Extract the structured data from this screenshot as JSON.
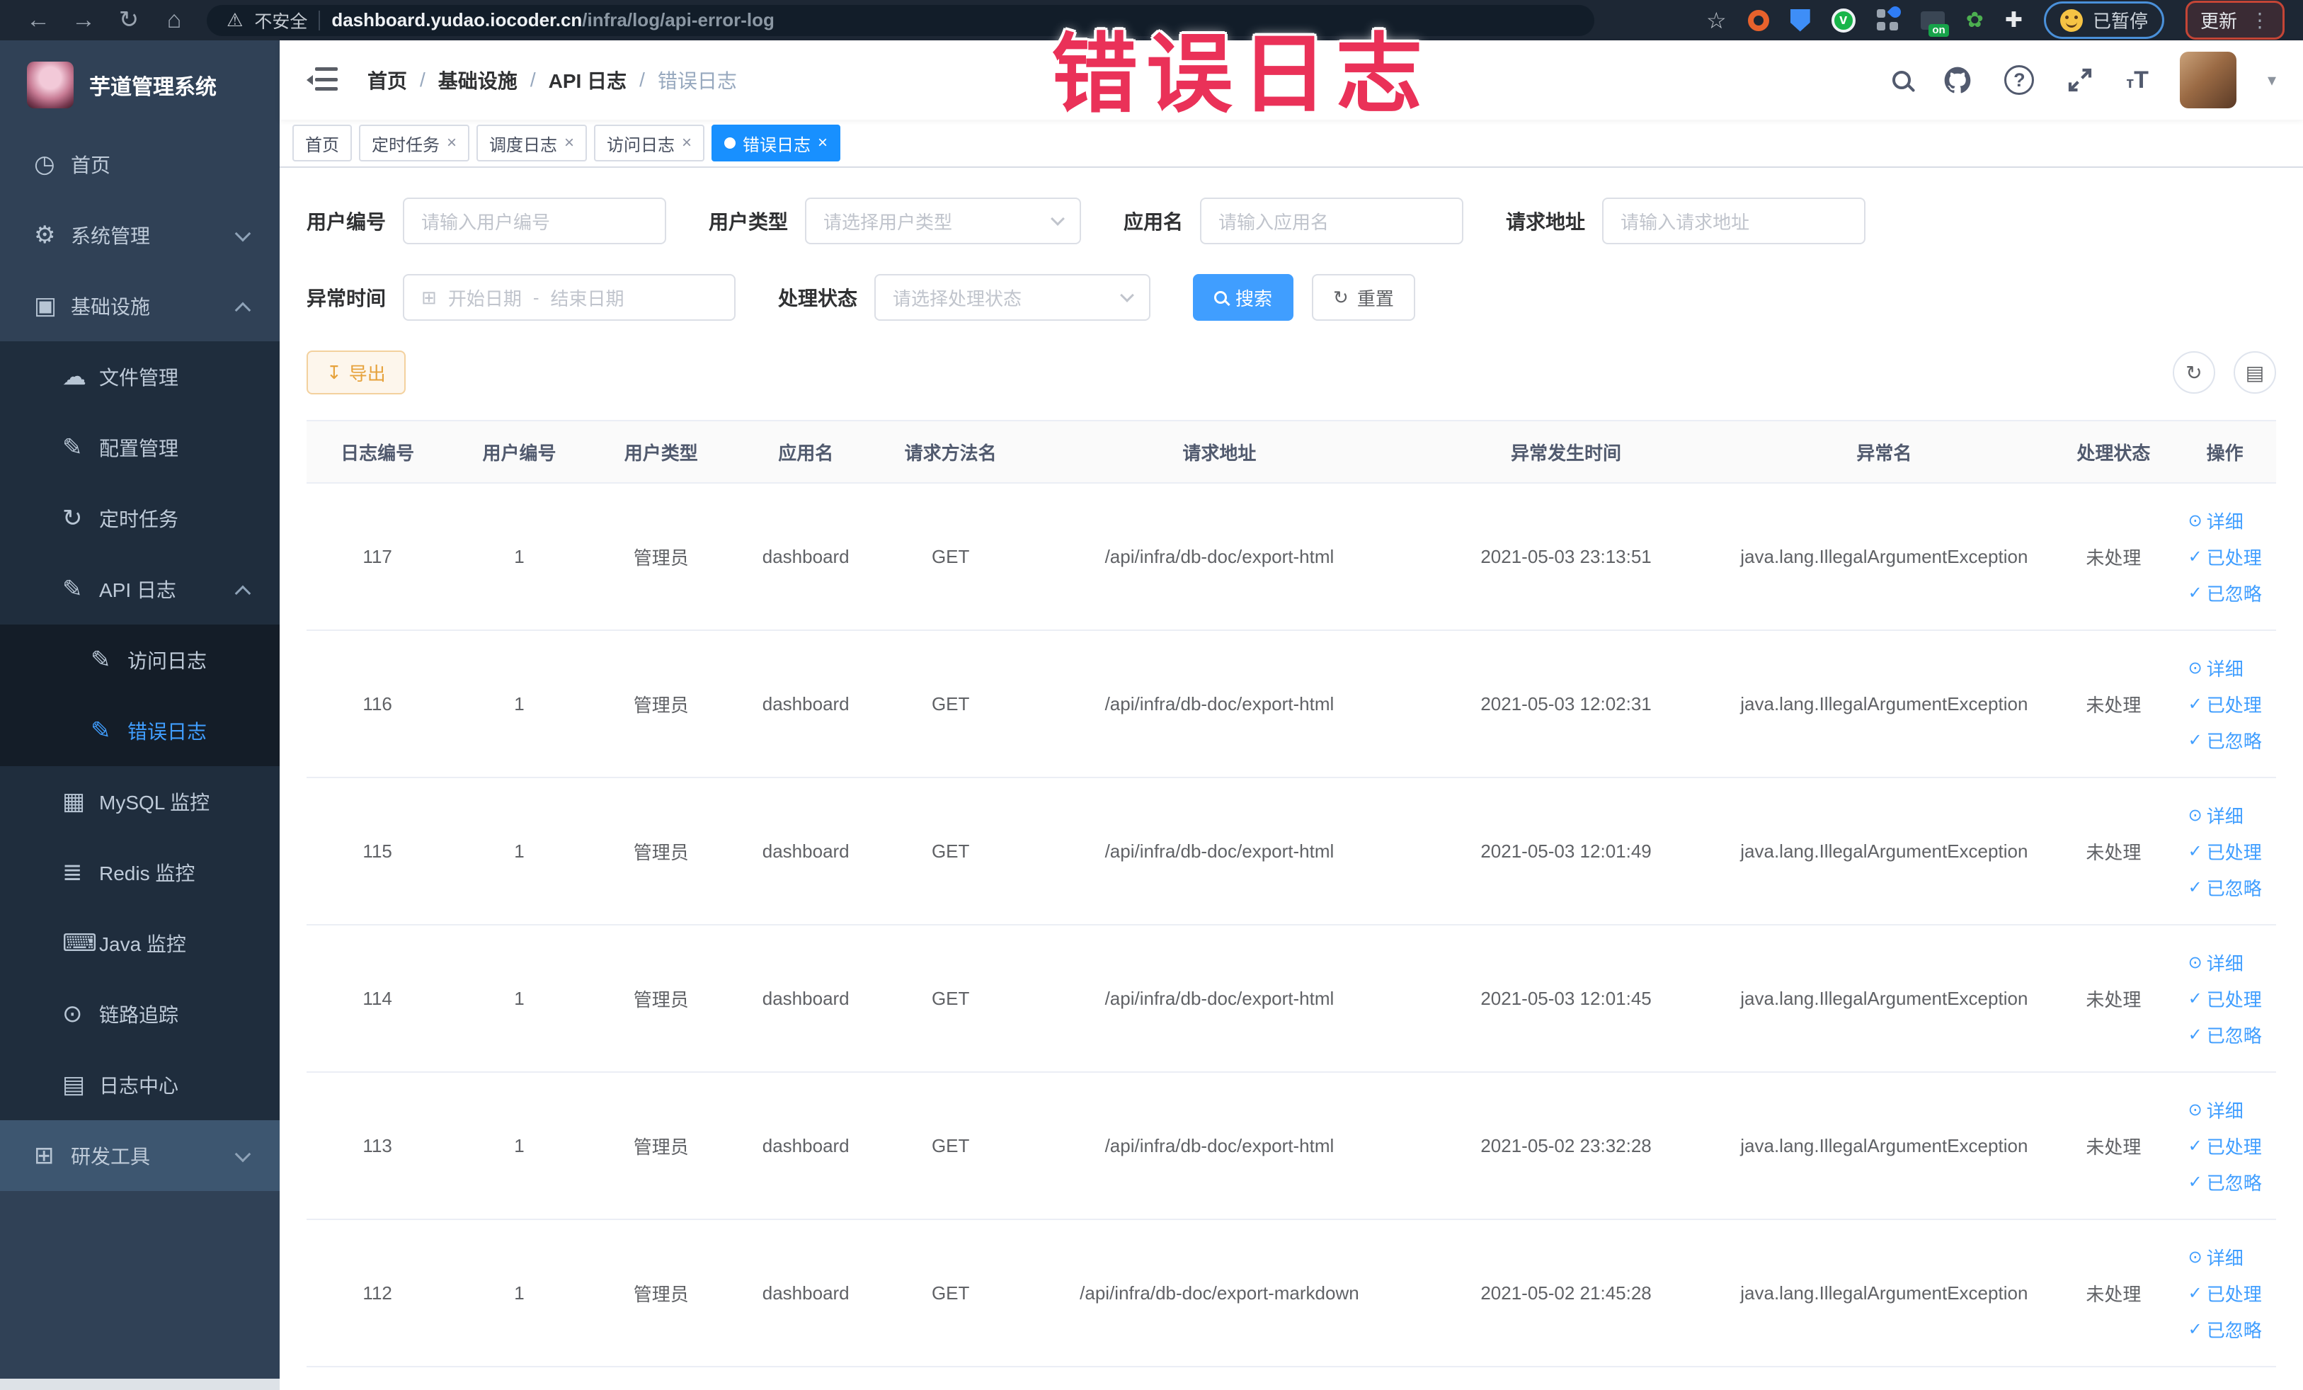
{
  "overlay": {
    "title": "错误日志"
  },
  "browser": {
    "security_label": "不安全",
    "url_domain": "dashboard.yudao.iocoder.cn",
    "url_path": "/infra/log/api-error-log",
    "extension_on_badge": "on",
    "gcircle_letter": "v",
    "paused_label": "已暂停",
    "update_label": "更新",
    "kebab": "⋮"
  },
  "sidebar": {
    "app_title": "芋道管理系统",
    "items": [
      {
        "label": "首页",
        "level": 1,
        "icon": "gauge-icon",
        "chevron": "",
        "active": false,
        "hovered": false
      },
      {
        "label": "系统管理",
        "level": 1,
        "icon": "gear-icon",
        "chevron": "down",
        "active": false,
        "hovered": false
      },
      {
        "label": "基础设施",
        "level": 1,
        "icon": "monitor-icon",
        "chevron": "up",
        "active": false,
        "hovered": false
      },
      {
        "label": "文件管理",
        "level": 2,
        "icon": "cloud-icon",
        "chevron": "",
        "active": false,
        "hovered": false
      },
      {
        "label": "配置管理",
        "level": 2,
        "icon": "edit-icon",
        "chevron": "",
        "active": false,
        "hovered": false
      },
      {
        "label": "定时任务",
        "level": 2,
        "icon": "timer-icon",
        "chevron": "",
        "active": false,
        "hovered": false
      },
      {
        "label": "API 日志",
        "level": 2,
        "icon": "doc-edit-icon",
        "chevron": "up",
        "active": false,
        "hovered": false
      },
      {
        "label": "访问日志",
        "level": 3,
        "icon": "doc-edit-icon",
        "chevron": "",
        "active": false,
        "hovered": false
      },
      {
        "label": "错误日志",
        "level": 3,
        "icon": "doc-edit-icon",
        "chevron": "",
        "active": true,
        "hovered": false
      },
      {
        "label": "MySQL 监控",
        "level": 2,
        "icon": "chart-icon",
        "chevron": "",
        "active": false,
        "hovered": false
      },
      {
        "label": "Redis 监控",
        "level": 2,
        "icon": "layers-icon",
        "chevron": "",
        "active": false,
        "hovered": false
      },
      {
        "label": "Java 监控",
        "level": 2,
        "icon": "keyboard-icon",
        "chevron": "",
        "active": false,
        "hovered": false
      },
      {
        "label": "链路追踪",
        "level": 2,
        "icon": "eye-icon",
        "chevron": "",
        "active": false,
        "hovered": false
      },
      {
        "label": "日志中心",
        "level": 2,
        "icon": "log-icon",
        "chevron": "",
        "active": false,
        "hovered": false
      },
      {
        "label": "研发工具",
        "level": 1,
        "icon": "toolbox-icon",
        "chevron": "down",
        "active": false,
        "hovered": true
      }
    ]
  },
  "header": {
    "breadcrumb": [
      "首页",
      "基础设施",
      "API 日志",
      "错误日志"
    ]
  },
  "tabs": [
    {
      "label": "首页",
      "closable": false,
      "active": false
    },
    {
      "label": "定时任务",
      "closable": true,
      "active": false
    },
    {
      "label": "调度日志",
      "closable": true,
      "active": false
    },
    {
      "label": "访问日志",
      "closable": true,
      "active": false
    },
    {
      "label": "错误日志",
      "closable": true,
      "active": true
    }
  ],
  "filters": {
    "user_id_label": "用户编号",
    "user_id_placeholder": "请输入用户编号",
    "user_type_label": "用户类型",
    "user_type_placeholder": "请选择用户类型",
    "app_name_label": "应用名",
    "app_name_placeholder": "请输入应用名",
    "request_url_label": "请求地址",
    "request_url_placeholder": "请输入请求地址",
    "exception_time_label": "异常时间",
    "start_date_placeholder": "开始日期",
    "range_separator": "-",
    "end_date_placeholder": "结束日期",
    "process_status_label": "处理状态",
    "process_status_placeholder": "请选择处理状态",
    "search_button": "搜索",
    "reset_button": "重置"
  },
  "toolbar": {
    "export_button": "导出"
  },
  "table": {
    "columns": [
      "日志编号",
      "用户编号",
      "用户类型",
      "应用名",
      "请求方法名",
      "请求地址",
      "异常发生时间",
      "异常名",
      "处理状态",
      "操作"
    ],
    "actions": [
      {
        "label": "详细",
        "icon": "eye-icon"
      },
      {
        "label": "已处理",
        "icon": "check-icon"
      },
      {
        "label": "已忽略",
        "icon": "check-icon"
      }
    ],
    "rows": [
      {
        "id": "117",
        "user_id": "1",
        "user_type": "管理员",
        "app": "dashboard",
        "method": "GET",
        "url": "/api/infra/db-doc/export-html",
        "time": "2021-05-03 23:13:51",
        "exception": "java.lang.IllegalArgumentException",
        "status": "未处理"
      },
      {
        "id": "116",
        "user_id": "1",
        "user_type": "管理员",
        "app": "dashboard",
        "method": "GET",
        "url": "/api/infra/db-doc/export-html",
        "time": "2021-05-03 12:02:31",
        "exception": "java.lang.IllegalArgumentException",
        "status": "未处理"
      },
      {
        "id": "115",
        "user_id": "1",
        "user_type": "管理员",
        "app": "dashboard",
        "method": "GET",
        "url": "/api/infra/db-doc/export-html",
        "time": "2021-05-03 12:01:49",
        "exception": "java.lang.IllegalArgumentException",
        "status": "未处理"
      },
      {
        "id": "114",
        "user_id": "1",
        "user_type": "管理员",
        "app": "dashboard",
        "method": "GET",
        "url": "/api/infra/db-doc/export-html",
        "time": "2021-05-03 12:01:45",
        "exception": "java.lang.IllegalArgumentException",
        "status": "未处理"
      },
      {
        "id": "113",
        "user_id": "1",
        "user_type": "管理员",
        "app": "dashboard",
        "method": "GET",
        "url": "/api/infra/db-doc/export-html",
        "time": "2021-05-02 23:32:28",
        "exception": "java.lang.IllegalArgumentException",
        "status": "未处理"
      },
      {
        "id": "112",
        "user_id": "1",
        "user_type": "管理员",
        "app": "dashboard",
        "method": "GET",
        "url": "/api/infra/db-doc/export-markdown",
        "time": "2021-05-02 21:45:28",
        "exception": "java.lang.IllegalArgumentException",
        "status": "未处理"
      }
    ]
  }
}
